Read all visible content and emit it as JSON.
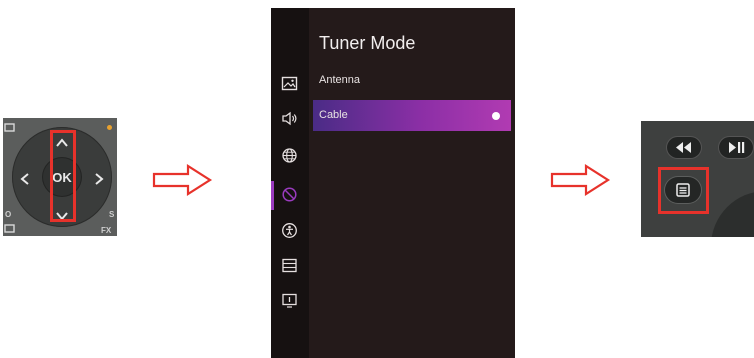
{
  "remote_dpad": {
    "center_label": "OK",
    "corner_label": "FX",
    "side_label_left": "O",
    "side_label_right": "S",
    "icons": [
      "up-arrow-icon",
      "down-arrow-icon",
      "left-arrow-icon",
      "right-arrow-icon"
    ]
  },
  "tv_menu": {
    "title": "Tuner Mode",
    "options": [
      {
        "label": "Antenna",
        "selected": false
      },
      {
        "label": "Cable",
        "selected": true
      }
    ],
    "sidebar_icons": [
      "picture-icon",
      "sound-icon",
      "network-icon",
      "channel-icon",
      "accessibility-icon",
      "system-icon",
      "support-icon"
    ],
    "active_sidebar_icon": "channel-icon"
  },
  "remote_menu": {
    "icons": [
      "rewind-icon",
      "play-pause-icon",
      "menu-icon"
    ]
  },
  "colors": {
    "highlight": "#e7322b",
    "arrow": "#e7322b",
    "selection_start": "#4a2c86",
    "selection_end": "#b13bb2"
  }
}
